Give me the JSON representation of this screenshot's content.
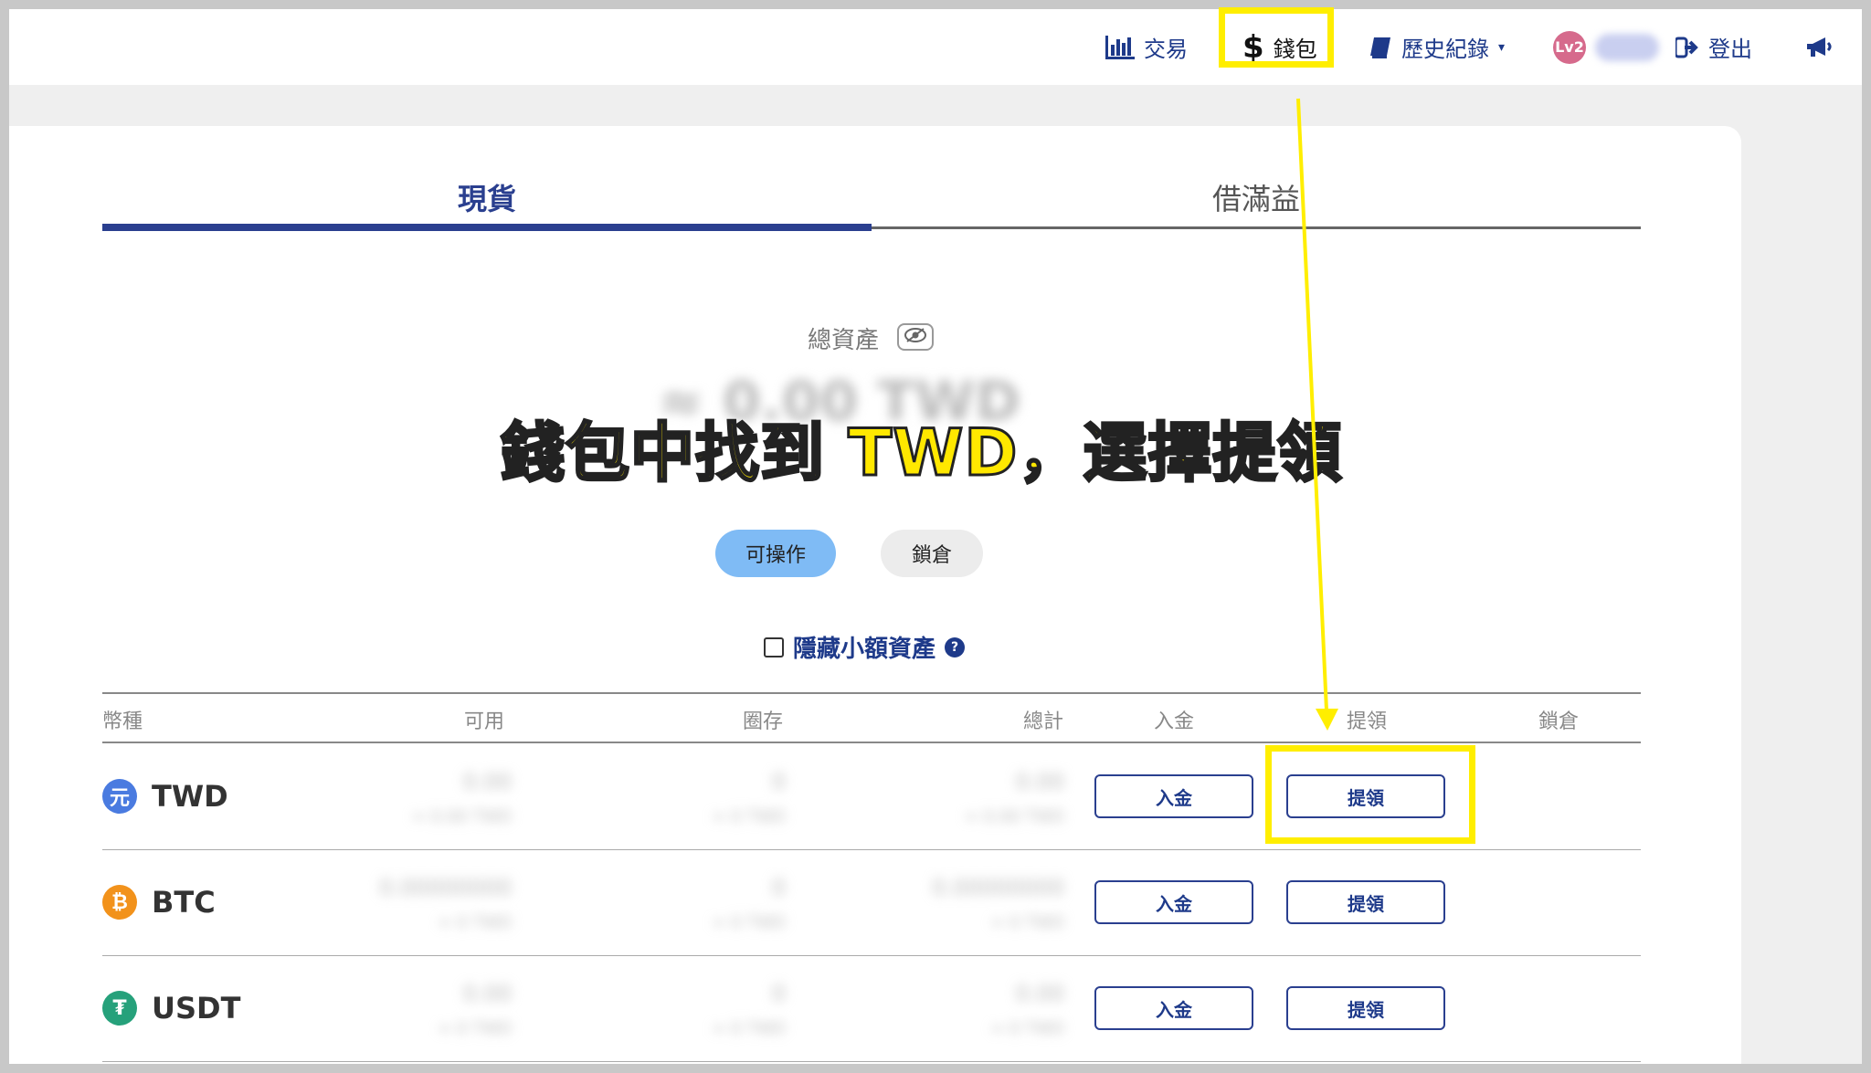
{
  "nav": {
    "trade": "交易",
    "wallet": "錢包",
    "history": "歷史紀錄",
    "user_level": "Lv2",
    "logout": "登出"
  },
  "tabs": [
    {
      "label": "現貨",
      "active": true
    },
    {
      "label": "借滿益",
      "active": false
    }
  ],
  "summary": {
    "total_label": "總資產",
    "total_value": "≈ 0.00 TWD"
  },
  "overlay": {
    "instruction": "錢包中找到 TWD，選擇提領"
  },
  "filters": {
    "operable": "可操作",
    "locked": "鎖倉"
  },
  "hide_small": {
    "label": "隱藏小額資產",
    "help_icon": "?"
  },
  "table": {
    "headers": [
      "幣種",
      "可用",
      "圈存",
      "總計",
      "入金",
      "提領",
      "鎖倉"
    ],
    "rows": [
      {
        "symbol": "TWD",
        "icon": "元",
        "icon_color": "#4a7be0",
        "available": "0.00",
        "available_sub": "≈ 0.00 TWD",
        "reserved": "0",
        "reserved_sub": "≈ 0 TWD",
        "total": "0.00",
        "total_sub": "≈ 0.00 TWD",
        "deposit": "入金",
        "withdraw": "提領"
      },
      {
        "symbol": "BTC",
        "icon": "₿",
        "icon_color": "#f2921b",
        "available": "0.00000000",
        "available_sub": "≈ 0 TWD",
        "reserved": "0",
        "reserved_sub": "≈ 0 TWD",
        "total": "0.00000000",
        "total_sub": "≈ 0 TWD",
        "deposit": "入金",
        "withdraw": "提領"
      },
      {
        "symbol": "USDT",
        "icon": "₮",
        "icon_color": "#26a17b",
        "available": "0.00",
        "available_sub": "≈ 0 TWD",
        "reserved": "0",
        "reserved_sub": "≈ 0 TWD",
        "total": "0.00",
        "total_sub": "≈ 0 TWD",
        "deposit": "入金",
        "withdraw": "提領"
      }
    ]
  },
  "colors": {
    "brand": "#1e3a8a",
    "highlight": "#ffee00",
    "pill_active": "#7fbbf5",
    "pill_inactive": "#ececec"
  }
}
